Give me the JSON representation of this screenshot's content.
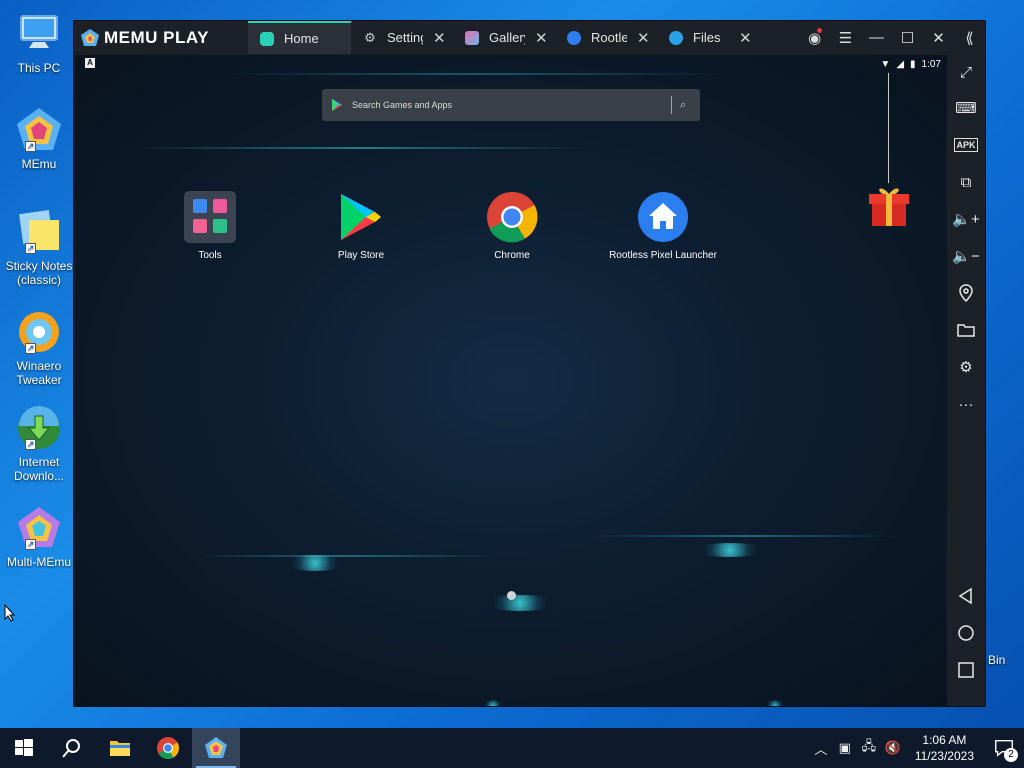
{
  "desktop": {
    "icons": [
      {
        "label": "This PC"
      },
      {
        "label": "MEmu"
      },
      {
        "label": "Sticky Notes (classic)"
      },
      {
        "label": "Winaero Tweaker"
      },
      {
        "label": "Internet Downlo..."
      },
      {
        "label": "Multi-MEmu"
      }
    ],
    "recycle_bin_label": "Bin"
  },
  "memu": {
    "brand": "MEMU PLAY",
    "tabs": [
      {
        "label": "Home",
        "icon": "home-app-icon",
        "active": true
      },
      {
        "label": "Setting",
        "icon": "gear-icon",
        "active": false
      },
      {
        "label": "Gallery",
        "icon": "gallery-icon",
        "active": false
      },
      {
        "label": "Rootles",
        "icon": "rootless-launcher-icon",
        "active": false
      },
      {
        "label": "Files",
        "icon": "files-icon",
        "active": false
      }
    ],
    "status_time": "1:07",
    "search_placeholder": "Search Games and Apps",
    "apps": [
      {
        "label": "Tools"
      },
      {
        "label": "Play Store"
      },
      {
        "label": "Chrome"
      },
      {
        "label": "Rootless Pixel Launcher"
      }
    ],
    "sidebar": [
      "fullscreen-icon",
      "keyboard-icon",
      "apk-icon",
      "multi-window-icon",
      "volume-up-icon",
      "volume-down-icon",
      "location-icon",
      "folder-icon",
      "settings-icon",
      "more-icon",
      "back-icon",
      "home-icon",
      "recents-icon"
    ],
    "apk_label": "APK"
  },
  "taskbar": {
    "time": "1:06 AM",
    "date": "11/23/2023",
    "notification_count": "2"
  },
  "colors": {
    "accent": "#2ad1b8",
    "titlebar": "#1c2027",
    "taskbar": "#0e1a2b"
  }
}
